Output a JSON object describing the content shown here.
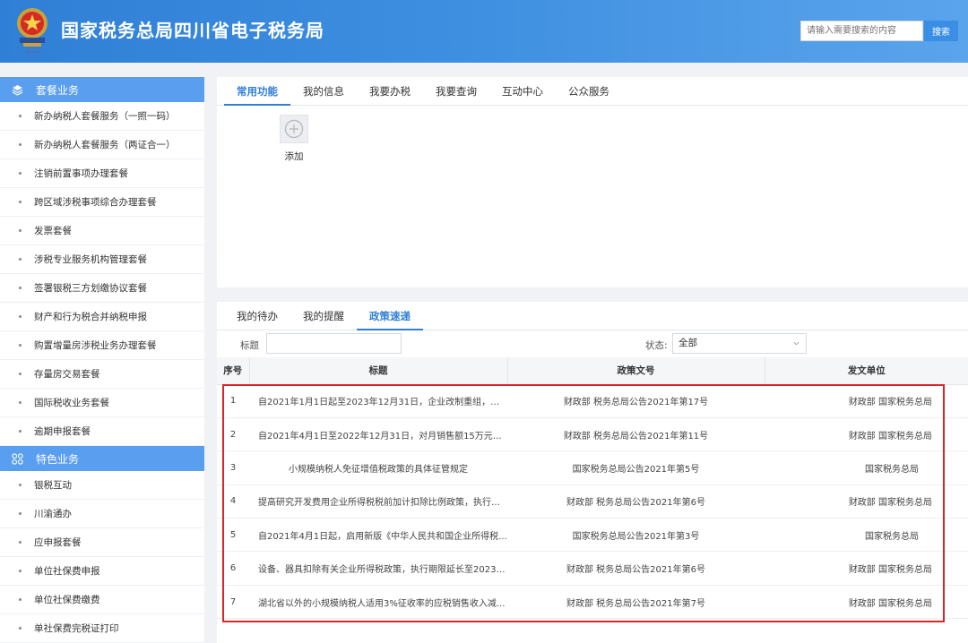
{
  "header": {
    "title": "国家税务总局四川省电子税务局",
    "logo_icon": "tax-emblem-icon",
    "search": {
      "placeholder": "请输入需要搜索的内容",
      "button": "搜索"
    }
  },
  "sidebar": {
    "sections": [
      {
        "title": "套餐业务",
        "icon": "layers-icon",
        "items": [
          "新办纳税人套餐服务（一照一码）",
          "新办纳税人套餐服务（两证合一）",
          "注销前置事项办理套餐",
          "跨区域涉税事项综合办理套餐",
          "发票套餐",
          "涉税专业服务机构管理套餐",
          "签署银税三方划缴协议套餐",
          "财产和行为税合并纳税申报",
          "购置增量房涉税业务办理套餐",
          "存量房交易套餐",
          "国际税收业务套餐",
          "逾期申报套餐"
        ]
      },
      {
        "title": "特色业务",
        "icon": "grid-icon",
        "items": [
          "银税互动",
          "川渝通办",
          "应申报套餐",
          "单位社保费申报",
          "单位社保费缴费",
          "单社保费完税证打印"
        ]
      }
    ]
  },
  "top_panel": {
    "tabs": [
      "常用功能",
      "我的信息",
      "我要办税",
      "我要查询",
      "互动中心",
      "公众服务"
    ],
    "active_tab": 0,
    "add_label": "添加"
  },
  "bottom_panel": {
    "tabs": [
      "我的待办",
      "我的提醒",
      "政策速递"
    ],
    "active_tab": 2,
    "filter": {
      "title_label": "标题",
      "status_label": "状态:",
      "status_value": "全部"
    },
    "table": {
      "headers": [
        "序号",
        "标题",
        "政策文号",
        "发文单位"
      ],
      "rows": [
        [
          "1",
          "自2021年1月1日起至2023年12月31日，企业改制重组，符合...",
          "财政部 税务总局公告2021年第17号",
          "财政部 国家税务总局"
        ],
        [
          "2",
          "自2021年4月1日至2022年12月31日，对月销售额15万元以下...",
          "财政部 税务总局公告2021年第11号",
          "财政部 国家税务总局"
        ],
        [
          "3",
          "小规模纳税人免征增值税政策的具体征管规定",
          "国家税务总局公告2021年第5号",
          "国家税务总局"
        ],
        [
          "4",
          "提高研究开发费用企业所得税税前加计扣除比例政策，执行期...",
          "财政部 税务总局公告2021年第6号",
          "财政部 国家税务总局"
        ],
        [
          "5",
          "自2021年4月1日起，启用新版《中华人民共和国企业所得税...",
          "国家税务总局公告2021年第3号",
          "国家税务总局"
        ],
        [
          "6",
          "设备、器具扣除有关企业所得税政策，执行期限延长至2023年...",
          "财政部 税务总局公告2021年第6号",
          "财政部 国家税务总局"
        ],
        [
          "7",
          "湖北省以外的小规模纳税人适用3%征收率的应税销售收入减...",
          "财政部 税务总局公告2021年第7号",
          "财政部 国家税务总局"
        ]
      ]
    }
  },
  "colors": {
    "header_blue": "#2f7fd6",
    "sidebar_section": "#5a9ef0",
    "active_tab": "#2f7fd6",
    "highlight_border": "#d9252a"
  }
}
